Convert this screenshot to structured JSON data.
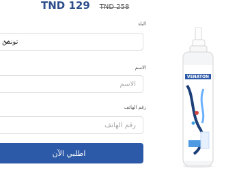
{
  "offer": {
    "price_new": "TND 129",
    "price_old": "TND 258"
  },
  "form": {
    "country_label": "البلد",
    "country_value": "تونس",
    "name_label": "الاسم",
    "name_placeholder": "الاسم",
    "phone_label": "رقم الهاتف",
    "phone_placeholder": "رقم الهاتف",
    "submit_label": "اطلبي الآن"
  },
  "product": {
    "brand": "VENATON"
  },
  "colors": {
    "accent": "#2d5aa8",
    "price": "#2d4e8a"
  }
}
